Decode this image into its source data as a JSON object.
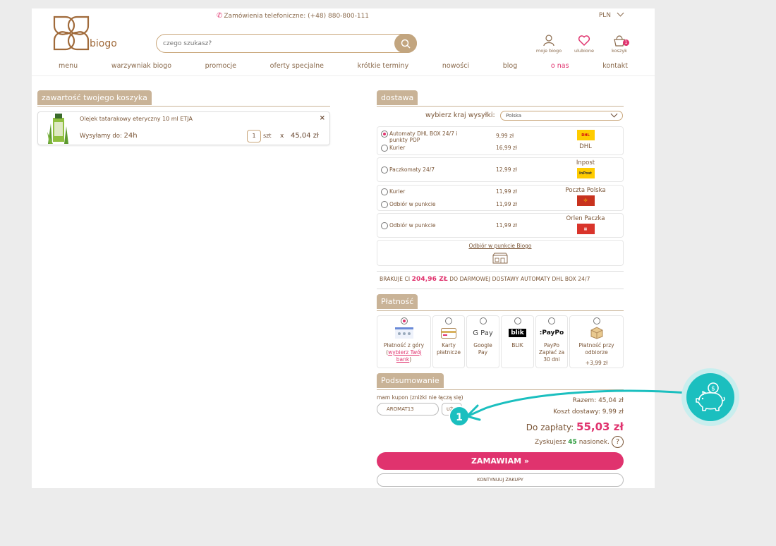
{
  "header": {
    "phone_text": "Zamówienia telefoniczne: (+48) 880-800-111",
    "currency": "PLN",
    "logo_text": "biogo",
    "search_placeholder": "czego szukasz?",
    "icons": [
      {
        "label": "moje biogo",
        "icon": "user-icon"
      },
      {
        "label": "ulubione",
        "icon": "heart-icon"
      },
      {
        "label": "koszyk",
        "icon": "basket-icon",
        "badge": "1"
      }
    ]
  },
  "nav": {
    "items": [
      "menu",
      "warzywniak biogo",
      "promocje",
      "oferty specjalne",
      "krótkie terminy",
      "nowości",
      "blog",
      "o nas",
      "kontakt"
    ],
    "active_item": "o nas"
  },
  "cart": {
    "title": "zawartość twojego koszyka",
    "item": {
      "name": "Olejek tatarakowy eteryczny 10 ml ETJA",
      "shipping_label": "Wysyłamy do:",
      "shipping_value": "24h",
      "quantity": "1",
      "unit": "szt",
      "times": "x",
      "price": "45,04 zł",
      "remove": "×"
    }
  },
  "delivery": {
    "title": "dostawa",
    "country_label": "wybierz kraj wysyłki:",
    "country_value": "Polska",
    "groups": [
      {
        "carrier": "DHL",
        "options": [
          {
            "label": "Automaty DHL BOX 24/7 i punkty POP",
            "price": "9,99 zł",
            "selected": true
          },
          {
            "label": "Kurier",
            "price": "16,99 zł",
            "selected": false
          }
        ]
      },
      {
        "carrier": "Inpost",
        "options": [
          {
            "label": "Paczkomaty 24/7",
            "price": "12,99 zł",
            "selected": false
          }
        ]
      },
      {
        "carrier": "Poczta Polska",
        "options": [
          {
            "label": "Kurier",
            "price": "11,99 zł",
            "selected": false
          },
          {
            "label": "Odbiór w punkcie",
            "price": "11,99 zł",
            "selected": false
          }
        ]
      },
      {
        "carrier": "Orlen Paczka",
        "options": [
          {
            "label": "Odbiór w punkcie",
            "price": "11,99 zł",
            "selected": false
          }
        ]
      }
    ],
    "pickup_link": "Odbiór w punkcie Biogo",
    "free_shipping": {
      "prefix": "BRAKUJE CI",
      "amount": "204,96 ZŁ",
      "suffix": "DO DARMOWEJ DOSTAWY AUTOMATY DHL BOX 24/7"
    }
  },
  "payment": {
    "title": "Płatność",
    "methods": [
      {
        "label_pre": "Płatność z góry (",
        "link": "wybierz Twój bank",
        "label_post": ")",
        "selected": true
      },
      {
        "label": "Karty płatnicze",
        "selected": false
      },
      {
        "label": "Google Pay",
        "selected": false
      },
      {
        "label": "BLIK",
        "selected": false
      },
      {
        "label": "PayPo Zapłać za 30 dni",
        "selected": false
      },
      {
        "label": "Płatność przy odbiorze",
        "extra": "+3,99 zł",
        "selected": false
      }
    ],
    "logo_text": {
      "gpay": "G Pay",
      "blik": "blik",
      "paypo": ":PayPo"
    }
  },
  "summary": {
    "title": "Podsumowanie",
    "coupon_label": "mam kupon (zniżki nie łączą się)",
    "coupon_value": "AROMAT13",
    "use_button": "UŻYJ",
    "subtotal": "Razem: 45,04 zł",
    "shipping_cost": "Koszt dostawy: 9,99 zł",
    "total_label": "Do zapłaty:",
    "total_value": "55,03 zł",
    "points_prefix": "Zyskujesz",
    "points_value": "45",
    "points_suffix": "nasionek.",
    "help": "?",
    "order_button": "ZAMAWIAM »",
    "continue_button": "KONTYNUUJ ZAKUPY"
  },
  "annotation": {
    "step_number": "1"
  },
  "colors": {
    "accent": "#e0336e",
    "beige": "#c9b397",
    "teal": "#1bbfbf",
    "brown": "#7a5536"
  }
}
